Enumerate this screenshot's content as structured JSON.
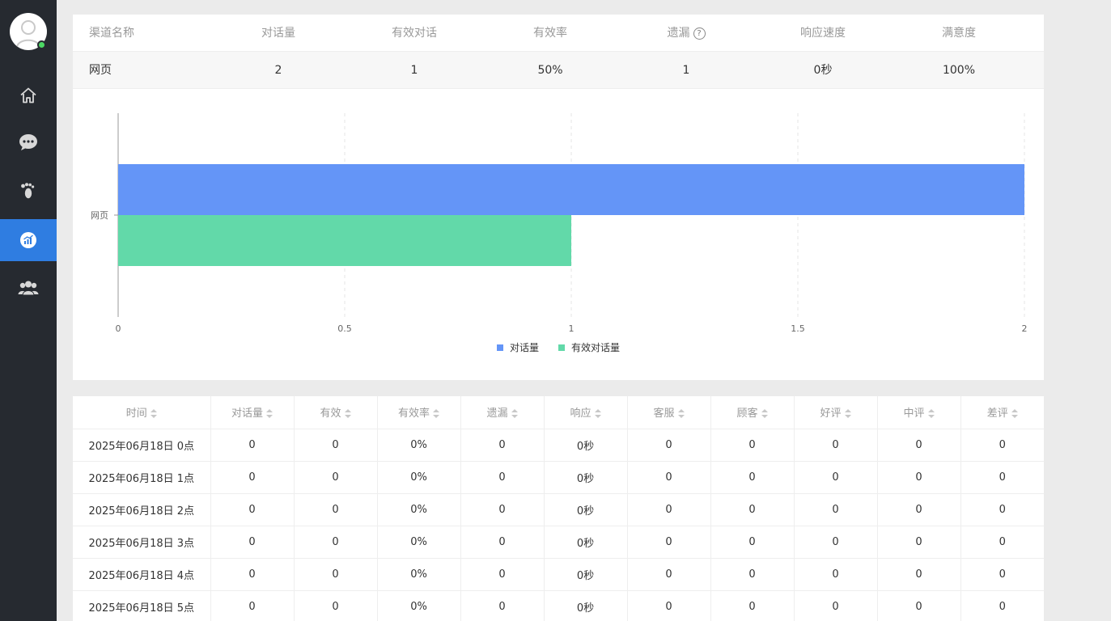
{
  "sidebar": {
    "status_color": "#4cd964",
    "items": [
      {
        "icon": "home-icon",
        "active": false
      },
      {
        "icon": "chat-bubble-icon",
        "active": false
      },
      {
        "icon": "footprints-icon",
        "active": false
      },
      {
        "icon": "analytics-chart-icon",
        "active": true
      },
      {
        "icon": "user-group-icon",
        "active": false
      }
    ]
  },
  "summary": {
    "headers": [
      "渠道名称",
      "对话量",
      "有效对话",
      "有效率",
      "遗漏",
      "响应速度",
      "满意度"
    ],
    "help_icon": "?",
    "row": [
      "网页",
      "2",
      "1",
      "50%",
      "1",
      "0秒",
      "100%"
    ]
  },
  "chart_data": {
    "type": "bar",
    "orientation": "horizontal",
    "categories": [
      "网页"
    ],
    "series": [
      {
        "name": "对话量",
        "values": [
          2
        ],
        "color": "#6495f7"
      },
      {
        "name": "有效对话量",
        "values": [
          1
        ],
        "color": "#62d9a9"
      }
    ],
    "xlim": [
      0,
      2
    ],
    "x_ticks": [
      "0",
      "0.5",
      "1",
      "1.5",
      "2"
    ],
    "grid": true,
    "legend_position": "bottom-center"
  },
  "table": {
    "headers": [
      "时间",
      "对话量",
      "有效",
      "有效率",
      "遗漏",
      "响应",
      "客服",
      "顾客",
      "好评",
      "中评",
      "差评"
    ],
    "rows": [
      [
        "2025年06月18日 0点",
        "0",
        "0",
        "0%",
        "0",
        "0秒",
        "0",
        "0",
        "0",
        "0",
        "0"
      ],
      [
        "2025年06月18日 1点",
        "0",
        "0",
        "0%",
        "0",
        "0秒",
        "0",
        "0",
        "0",
        "0",
        "0"
      ],
      [
        "2025年06月18日 2点",
        "0",
        "0",
        "0%",
        "0",
        "0秒",
        "0",
        "0",
        "0",
        "0",
        "0"
      ],
      [
        "2025年06月18日 3点",
        "0",
        "0",
        "0%",
        "0",
        "0秒",
        "0",
        "0",
        "0",
        "0",
        "0"
      ],
      [
        "2025年06月18日 4点",
        "0",
        "0",
        "0%",
        "0",
        "0秒",
        "0",
        "0",
        "0",
        "0",
        "0"
      ],
      [
        "2025年06月18日 5点",
        "0",
        "0",
        "0%",
        "0",
        "0秒",
        "0",
        "0",
        "0",
        "0",
        "0"
      ]
    ]
  }
}
